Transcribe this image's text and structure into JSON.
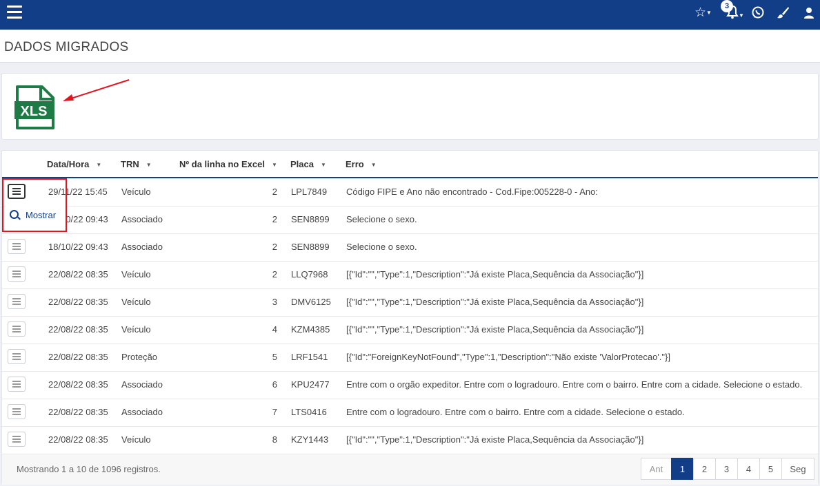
{
  "header": {
    "title": "DADOS MIGRADOS",
    "notification_count": "3"
  },
  "export": {
    "xls_label": "XLS"
  },
  "table": {
    "columns": [
      "Data/Hora",
      "TRN",
      "Nº da linha no Excel",
      "Placa",
      "Erro"
    ],
    "rows": [
      [
        "29/11/22 15:45",
        "Veículo",
        "2",
        "LPL7849",
        "Código FIPE e Ano não encontrado - Cod.Fipe:005228-0 - Ano:"
      ],
      [
        "18/10/22 09:43",
        "Associado",
        "2",
        "SEN8899",
        "Selecione o sexo."
      ],
      [
        "18/10/22 09:43",
        "Associado",
        "2",
        "SEN8899",
        "Selecione o sexo."
      ],
      [
        "22/08/22 08:35",
        "Veículo",
        "2",
        "LLQ7968",
        "[{\"Id\":\"\",\"Type\":1,\"Description\":\"Já existe Placa,Sequência da Associação\"}]"
      ],
      [
        "22/08/22 08:35",
        "Veículo",
        "3",
        "DMV6125",
        "[{\"Id\":\"\",\"Type\":1,\"Description\":\"Já existe Placa,Sequência da Associação\"}]"
      ],
      [
        "22/08/22 08:35",
        "Veículo",
        "4",
        "KZM4385",
        "[{\"Id\":\"\",\"Type\":1,\"Description\":\"Já existe Placa,Sequência da Associação\"}]"
      ],
      [
        "22/08/22 08:35",
        "Proteção",
        "5",
        "LRF1541",
        "[{\"Id\":\"ForeignKeyNotFound\",\"Type\":1,\"Description\":\"Não existe 'ValorProtecao'.\"}]"
      ],
      [
        "22/08/22 08:35",
        "Associado",
        "6",
        "KPU2477",
        "Entre com o orgão expeditor. Entre com o logradouro. Entre com o bairro. Entre com a cidade. Selecione o estado."
      ],
      [
        "22/08/22 08:35",
        "Associado",
        "7",
        "LTS0416",
        "Entre com o logradouro. Entre com o bairro. Entre com a cidade. Selecione o estado."
      ],
      [
        "22/08/22 08:35",
        "Veículo",
        "8",
        "KZY1443",
        "[{\"Id\":\"\",\"Type\":1,\"Description\":\"Já existe Placa,Sequência da Associação\"}]"
      ]
    ]
  },
  "row_menu": {
    "show_label": "Mostrar"
  },
  "footer": {
    "info": "Mostrando 1 a 10 de 1096 registros."
  },
  "pagination": {
    "prev": "Ant",
    "pages": [
      "1",
      "2",
      "3",
      "4",
      "5"
    ],
    "next": "Seg",
    "current": "1"
  },
  "colors": {
    "primary": "#123d87",
    "excel_green": "#1e7b45",
    "highlight_red": "#e3141b"
  }
}
